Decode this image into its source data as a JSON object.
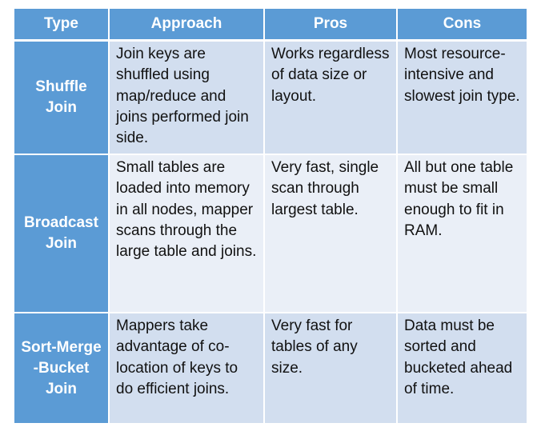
{
  "table": {
    "headers": [
      "Type",
      "Approach",
      "Pros",
      "Cons"
    ],
    "rows": [
      {
        "type": "Shuffle\nJoin",
        "approach": "Join keys are shuffled using map/reduce and joins performed join side.",
        "pros": "Works regardless of data size or layout.",
        "cons": "Most resource-intensive and slowest join type."
      },
      {
        "type": "Broadcast\nJoin",
        "approach": "Small tables are loaded into memory in all nodes, mapper scans through the large table and joins.",
        "pros": "Very fast, single scan through largest table.",
        "cons": "All but one table must be small enough to fit in RAM."
      },
      {
        "type": "Sort-Merge\n-Bucket\nJoin",
        "approach": "Mappers take advantage of co-location of keys to do efficient joins.",
        "pros": "Very fast for tables of any size.",
        "cons": "Data must be sorted and bucketed ahead of time."
      }
    ]
  },
  "colors": {
    "header_bg": "#5b9bd5",
    "row_band_a": "#d2deef",
    "row_band_b": "#eaeff7",
    "header_text": "#ffffff"
  }
}
